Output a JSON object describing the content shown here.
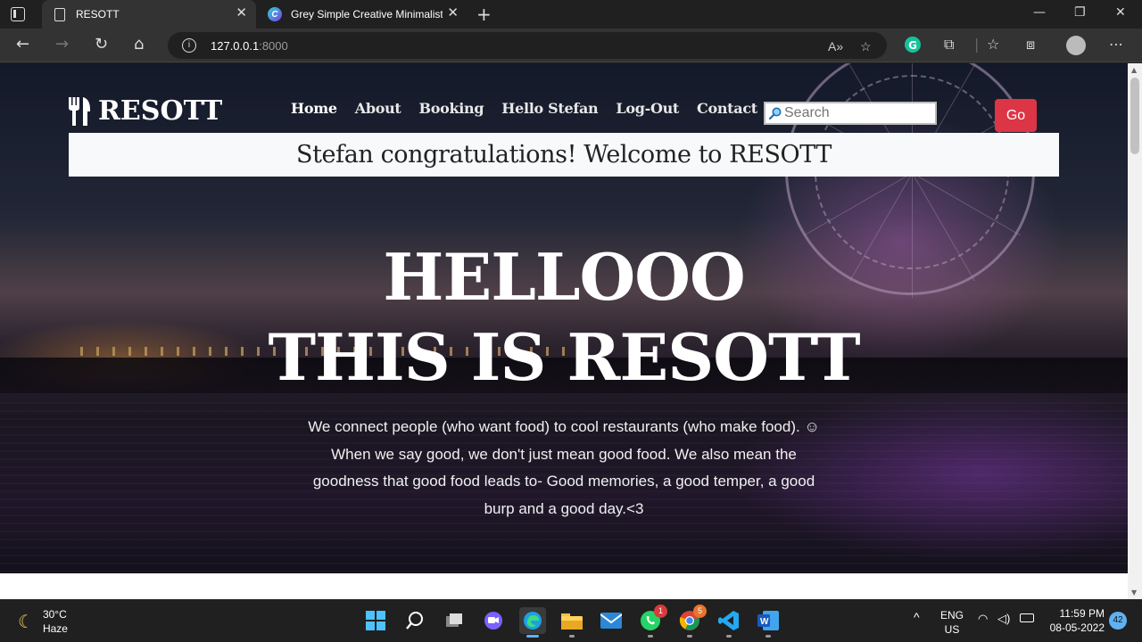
{
  "browser": {
    "tabs": [
      {
        "title": "RESOTT",
        "active": true
      },
      {
        "title": "Grey Simple Creative Minimalist",
        "active": false
      }
    ],
    "address": {
      "host": "127.0.0.1",
      "port": ":8000"
    }
  },
  "site": {
    "brand": "RESOTT",
    "nav": [
      "Home",
      "About",
      "Booking",
      "Hello Stefan",
      "Log-Out",
      "Contact"
    ],
    "search_placeholder": "Search",
    "search_button": "Go",
    "alert": "Stefan congratulations! Welcome to RESOTT",
    "hero_line1": "HELLOOO",
    "hero_line2": "THIS IS RESOTT",
    "lead": "We connect people (who want food) to cool restaurants (who make food). ☺ When we say good, we don't just mean good food. We also mean the goodness that good food leads to- Good memories, a good temper, a good burp and a good day.<3"
  },
  "taskbar": {
    "weather_temp": "30°C",
    "weather_desc": "Haze",
    "whatsapp_badge": "1",
    "chrome_badge": "5",
    "lang_top": "ENG",
    "lang_bottom": "US",
    "time": "11:59 PM",
    "date": "08-05-2022",
    "notifications": "42"
  },
  "colors": {
    "go_button": "#dc3545",
    "accent": "#5fb2f2"
  }
}
